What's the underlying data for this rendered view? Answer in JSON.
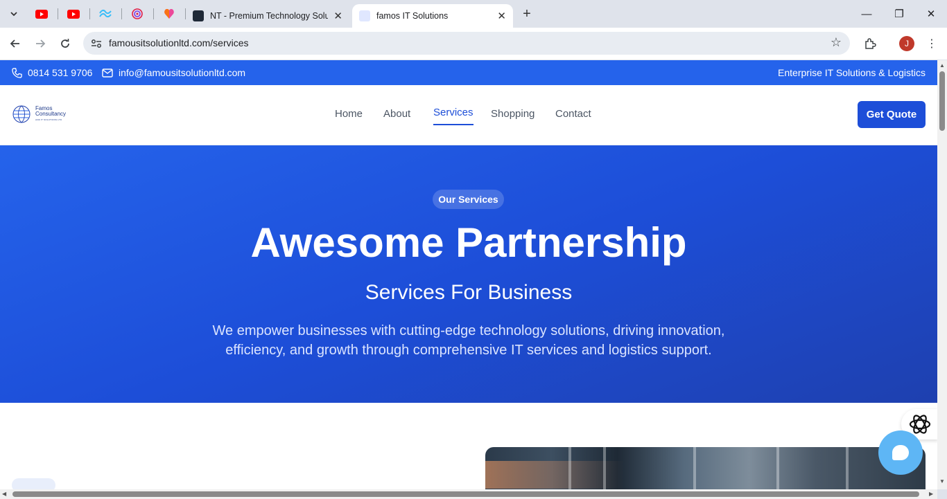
{
  "browser": {
    "pinned_tabs": [
      "youtube-icon",
      "youtube-icon",
      "tailwind-icon",
      "spiral-icon",
      "lovable-icon"
    ],
    "tabs": [
      {
        "title": "NT - Premium Technology Solut",
        "active": false
      },
      {
        "title": "famos IT Solutions",
        "active": true
      }
    ],
    "url": "famousitsolutionltd.com/services",
    "profile_initial": "J"
  },
  "topbar": {
    "phone": "0814 531 9706",
    "email": "info@famousitsolutionltd.com",
    "tagline": "Enterprise IT Solutions & Logistics"
  },
  "header": {
    "logo_line1": "Famos",
    "logo_line2": "Consultancy",
    "logo_line3": "AND IT SOLUTIONS LTD",
    "nav": [
      {
        "label": "Home",
        "active": false
      },
      {
        "label": "About",
        "active": false
      },
      {
        "label": "Services",
        "active": true
      },
      {
        "label": "Shopping",
        "active": false
      },
      {
        "label": "Contact",
        "active": false
      }
    ],
    "cta": "Get Quote"
  },
  "hero": {
    "badge": "Our Services",
    "title": "Awesome Partnership",
    "subtitle": "Services For Business",
    "description": "We empower businesses with cutting-edge technology solutions, driving innovation, efficiency, and growth through comprehensive IT services and logistics support."
  },
  "colors": {
    "brand_blue": "#2563eb",
    "nav_active": "#1d4ed8",
    "chat_button": "#5eb6f5"
  }
}
